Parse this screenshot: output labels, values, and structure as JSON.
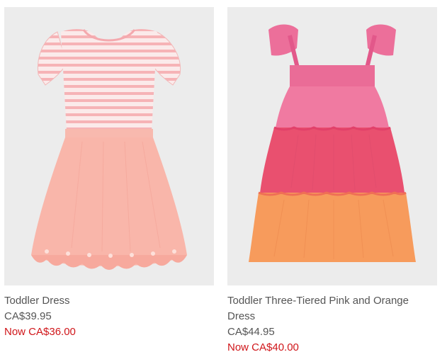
{
  "products": [
    {
      "name": "Toddler Dress",
      "price": "CA$39.95",
      "sale_price": "Now CA$36.00",
      "image_icon": "striped-top-pink-skirt-dress-image"
    },
    {
      "name": "Toddler Three-Tiered Pink and Orange Dress",
      "price": "CA$44.95",
      "sale_price": "Now CA$40.00",
      "image_icon": "three-tiered-pink-orange-dress-image"
    }
  ],
  "colors": {
    "image_bg": "#ececec",
    "text": "#555555",
    "sale": "#d0161a"
  }
}
